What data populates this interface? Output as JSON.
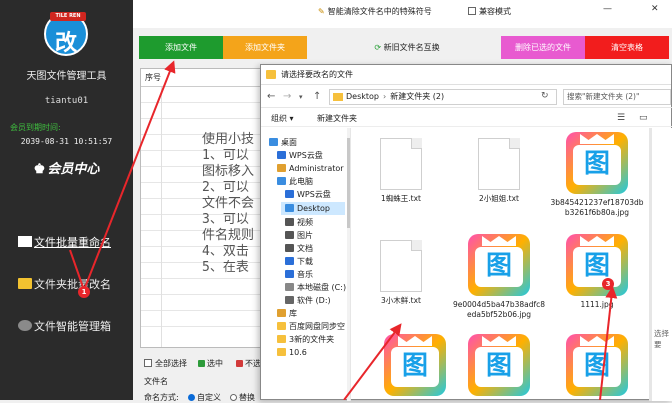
{
  "sidebar": {
    "logo_ribbon": "TILE REN",
    "logo_char": "改",
    "app_name": "天图文件管理工具",
    "username": "tiantu01",
    "membership_label": "会员到期时间:",
    "expiry_date": "2039-08-31 10:51:57",
    "vip_center": "会员中心",
    "nav": [
      {
        "label": "文件批量重命名"
      },
      {
        "label": "文件夹批量改名"
      },
      {
        "label": "文件智能管理箱"
      }
    ]
  },
  "topbar": {
    "special_chars": "智能清除文件名中的特殊符号",
    "compat_mode": "兼容模式",
    "minimize": "—",
    "close": "✕"
  },
  "toolbar": {
    "add_file": "添加文件",
    "add_folder": "添加文件夹",
    "swap_names": "新旧文件名互换",
    "remove_selected": "删除已选的文件",
    "clear_table": "清空表格"
  },
  "filelist": {
    "col_index": "序号"
  },
  "instructions": {
    "lines": [
      "使用小技",
      "1、可以",
      "图标移入",
      "2、可以",
      "文件不会",
      "3、可以",
      "件名规则",
      "4、双击",
      "5、在表"
    ]
  },
  "bottom": {
    "select_all": "全部选择",
    "select": "选中",
    "unselect": "不选",
    "filename_label": "文件名",
    "naming_mode": "命名方式:",
    "custom": "自定义",
    "replace": "替换"
  },
  "dialog": {
    "title": "请选择要改名的文件",
    "address": [
      "Desktop",
      "新建文件夹 (2)"
    ],
    "search_placeholder": "搜索\"新建文件夹 (2)\"",
    "organize": "组织",
    "new_folder": "新建文件夹",
    "tree": [
      {
        "label": "桌面",
        "color": "#3a8de0"
      },
      {
        "label": "WPS云盘",
        "color": "#2b6fd8"
      },
      {
        "label": "Administrator",
        "color": "#e0a030"
      },
      {
        "label": "此电脑",
        "color": "#3a8de0"
      },
      {
        "label": "WPS云盘",
        "color": "#2b6fd8"
      },
      {
        "label": "Desktop",
        "color": "#3a8de0"
      },
      {
        "label": "视频",
        "color": "#555555"
      },
      {
        "label": "图片",
        "color": "#555555"
      },
      {
        "label": "文档",
        "color": "#555555"
      },
      {
        "label": "下载",
        "color": "#2b6fd8"
      },
      {
        "label": "音乐",
        "color": "#2b6fd8"
      },
      {
        "label": "本地磁盘 (C:)",
        "color": "#888888"
      },
      {
        "label": "软件 (D:)",
        "color": "#666666"
      },
      {
        "label": "库",
        "color": "#e0a030"
      },
      {
        "label": "百度网盘同步空",
        "color": "#f6c03c"
      },
      {
        "label": "3新的文件夹",
        "color": "#f6c03c"
      },
      {
        "label": "10.6",
        "color": "#f6c03c"
      }
    ],
    "files": [
      {
        "name": "1蜘蛛王.txt",
        "kind": "txt"
      },
      {
        "name": "2小姐姐.txt",
        "kind": "txt"
      },
      {
        "name": "3b845421237ef18703dbb3261f6b80a.jpg",
        "kind": "pic"
      },
      {
        "name": "3小木鲜.txt",
        "kind": "txt"
      },
      {
        "name": "9e0004d5ba47b38adfc8eda5bf52b06.jpg",
        "kind": "pic"
      },
      {
        "name": "1111.jpg",
        "kind": "pic"
      },
      {
        "name": "",
        "kind": "pic"
      },
      {
        "name": "",
        "kind": "pic"
      },
      {
        "name": "",
        "kind": "pic"
      }
    ],
    "right_hint": "选择要"
  },
  "badges": {
    "one": "1",
    "three": "3"
  }
}
